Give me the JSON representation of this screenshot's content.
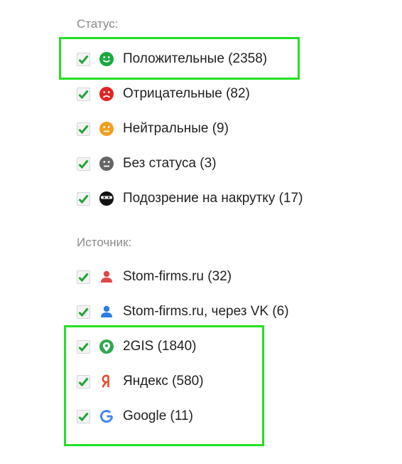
{
  "status_section": {
    "title": "Статус:",
    "items": [
      {
        "label": "Положительные (2358)",
        "icon": "smile-icon",
        "color": "#1aa93c",
        "checked": true
      },
      {
        "label": "Отрицательные (82)",
        "icon": "frown-icon",
        "color": "#e02424",
        "checked": true
      },
      {
        "label": "Нейтральные (9)",
        "icon": "neutral-face-icon",
        "color": "#f0a020",
        "checked": true
      },
      {
        "label": "Без статуса (3)",
        "icon": "no-status-face-icon",
        "color": "#666666",
        "checked": true
      },
      {
        "label": "Подозрение на накрутку (17)",
        "icon": "masked-face-icon",
        "color": "#111111",
        "checked": true
      }
    ]
  },
  "source_section": {
    "title": "Источник:",
    "items": [
      {
        "label": "Stom-firms.ru (32)",
        "icon": "user-red-icon",
        "color": "#e04848",
        "checked": true
      },
      {
        "label": "Stom-firms.ru, через VK (6)",
        "icon": "user-blue-icon",
        "color": "#2a7de1",
        "checked": true
      },
      {
        "label": "2GIS (1840)",
        "icon": "2gis-icon",
        "color": "#2fa84f",
        "checked": true
      },
      {
        "label": "Яндекс (580)",
        "icon": "yandex-icon",
        "color": "#e8472a",
        "checked": true
      },
      {
        "label": "Google (11)",
        "icon": "google-icon",
        "color": "#4285f4",
        "checked": true
      }
    ]
  },
  "colors": {
    "checkmark": "#1fa637",
    "highlight": "#22e022"
  }
}
